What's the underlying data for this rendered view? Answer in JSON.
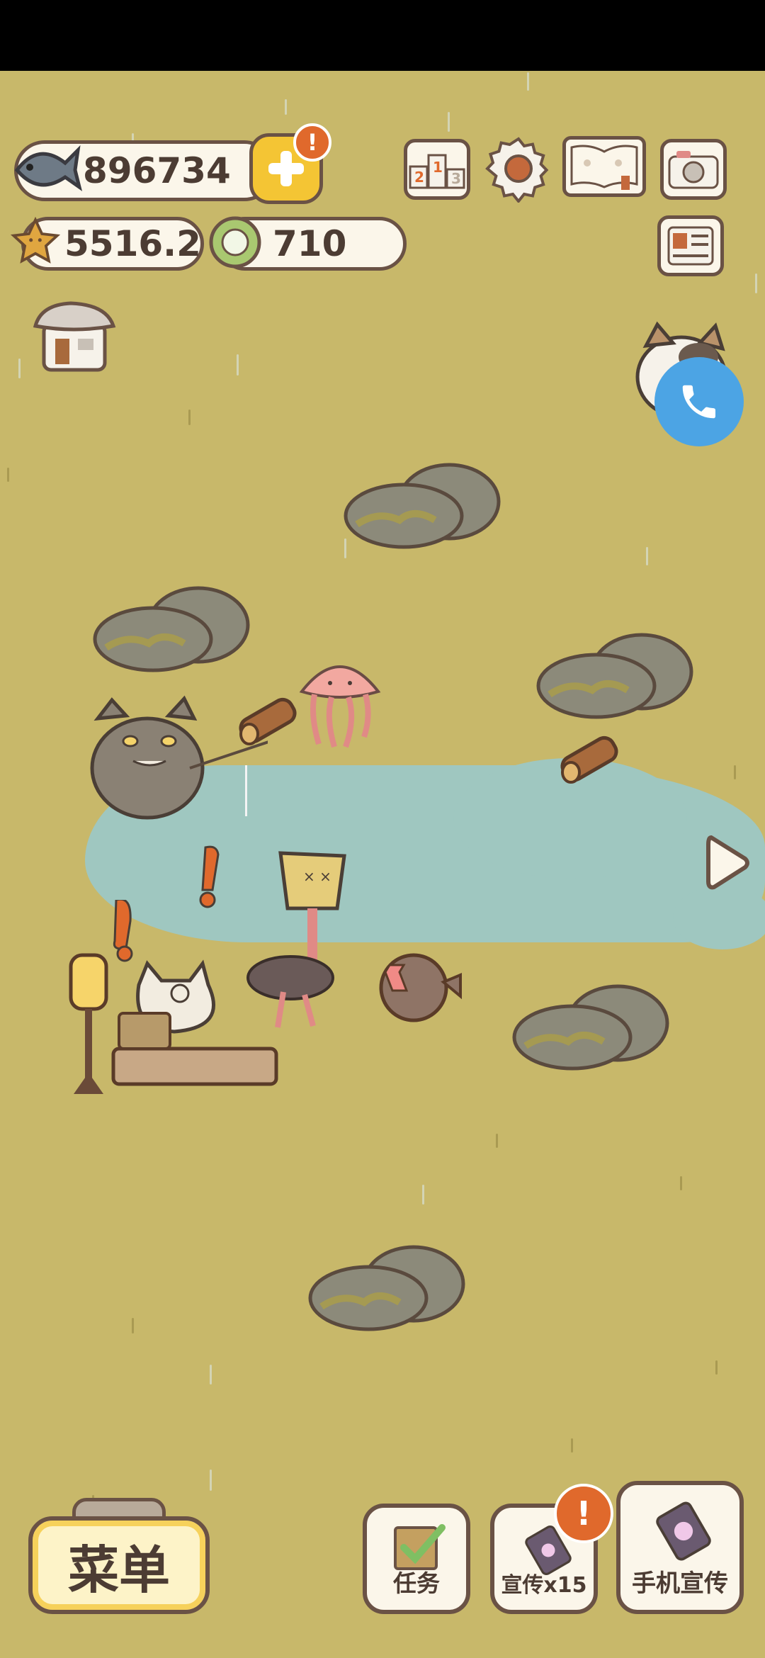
{
  "hud": {
    "fish_count": "896734",
    "star_currency": "5516.2",
    "token_currency": "710",
    "plus_badge": "!",
    "promo_badge": "!"
  },
  "icons": {
    "fish": "fish-icon",
    "star": "star-icon",
    "token": "token-icon",
    "ranking": "ranking-podium-icon",
    "settings": "gear-icon",
    "catalog": "paw-book-icon",
    "camera": "camera-icon",
    "news": "newspaper-icon",
    "shop": "shop-icon",
    "phone": "phone-icon"
  },
  "ranking_digits": {
    "first": "1",
    "second": "2",
    "third": "3"
  },
  "bottom": {
    "menu_label": "菜单",
    "tasks_label": "任务",
    "promote_label": "宣传x15",
    "phone_promote_label": "手机宣传"
  },
  "colors": {
    "field": "#c8b86a",
    "lake": "#9fc7c0",
    "outline": "#6a5245",
    "accent_yellow": "#f4c534",
    "alert_orange": "#e0692c",
    "phone_blue": "#4ca4e4"
  }
}
